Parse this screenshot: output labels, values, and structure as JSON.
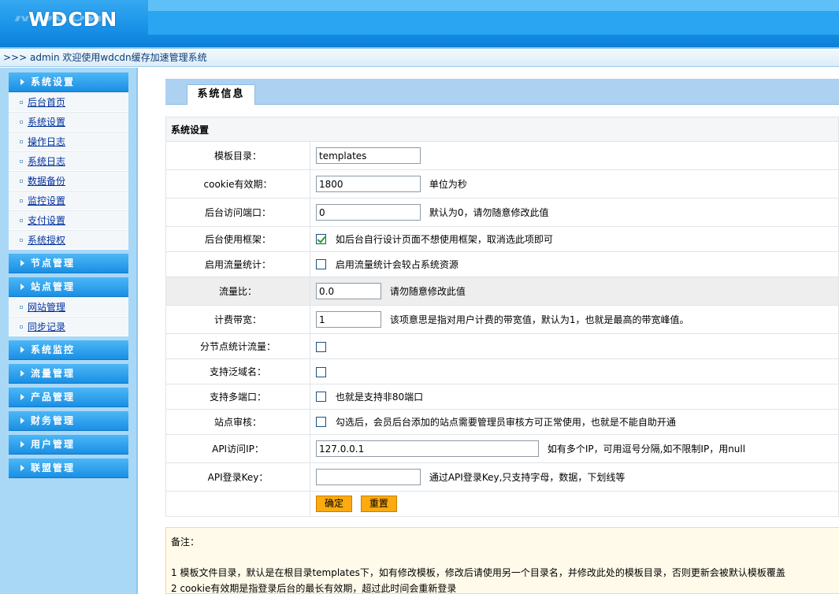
{
  "header": {
    "logo": "WDCDN"
  },
  "welcome": ">>> admin 欢迎使用wdcdn缓存加速管理系统",
  "sidebar": {
    "groups": [
      {
        "title": "系统设置",
        "items": [
          "后台首页",
          "系统设置",
          "操作日志",
          "系统日志",
          "数据备份",
          "监控设置",
          "支付设置",
          "系统授权"
        ]
      },
      {
        "title": "节点管理",
        "items": []
      },
      {
        "title": "站点管理",
        "items": [
          "网站管理",
          "同步记录"
        ]
      },
      {
        "title": "系统监控",
        "items": []
      },
      {
        "title": "流量管理",
        "items": []
      },
      {
        "title": "产品管理",
        "items": []
      },
      {
        "title": "财务管理",
        "items": []
      },
      {
        "title": "用户管理",
        "items": []
      },
      {
        "title": "联盟管理",
        "items": []
      }
    ]
  },
  "main": {
    "tab": "系统信息",
    "section": "系统设置",
    "fields": {
      "template_dir": {
        "label": "模板目录：",
        "value": "templates"
      },
      "cookie": {
        "label": "cookie有效期：",
        "value": "1800",
        "hint": "单位为秒"
      },
      "port": {
        "label": "后台访问端口：",
        "value": "0",
        "hint": "默认为0，请勿随意修改此值"
      },
      "frame": {
        "label": "后台使用框架：",
        "checked": true,
        "hint": "如后台自行设计页面不想使用框架，取消选此项即可"
      },
      "traffic_stat": {
        "label": "启用流量统计：",
        "checked": false,
        "hint": "启用流量统计会较占系统资源"
      },
      "traffic_ratio": {
        "label": "流量比：",
        "value": "0.0",
        "hint": "请勿随意修改此值"
      },
      "bandwidth": {
        "label": "计费带宽：",
        "value": "1",
        "hint": "该项意思是指对用户计费的带宽值，默认为1，也就是最高的带宽峰值。"
      },
      "node_traffic": {
        "label": "分节点统计流量：",
        "checked": false
      },
      "wildcard": {
        "label": "支持泛域名：",
        "checked": false
      },
      "multi_port": {
        "label": "支持多端口：",
        "checked": false,
        "hint": "也就是支持非80端口"
      },
      "site_audit": {
        "label": "站点审核：",
        "checked": false,
        "hint": "勾选后，会员后台添加的站点需要管理员审核方可正常使用，也就是不能自助开通"
      },
      "api_ip": {
        "label": "API访问IP：",
        "value": "127.0.0.1",
        "hint": "如有多个IP，可用逗号分隔,如不限制IP，用null"
      },
      "api_key": {
        "label": "API登录Key：",
        "value": "",
        "hint": "通过API登录Key,只支持字母，数据，下划线等"
      }
    },
    "buttons": {
      "confirm": "确定",
      "reset": "重置"
    },
    "notes": {
      "title": "备注：",
      "lines": [
        "1 模板文件目录，默认是在根目录templates下，如有修改模板，修改后请使用另一个目录名，并修改此处的模板目录，否则更新会被默认模板覆盖",
        "2 cookie有效期是指登录后台的最长有效期，超过此时间会重新登录"
      ]
    }
  },
  "colors": {
    "header_blue": "#1a93e8",
    "sidebar_bg": "#a9d8f7",
    "button_orange": "#fbaa10"
  }
}
